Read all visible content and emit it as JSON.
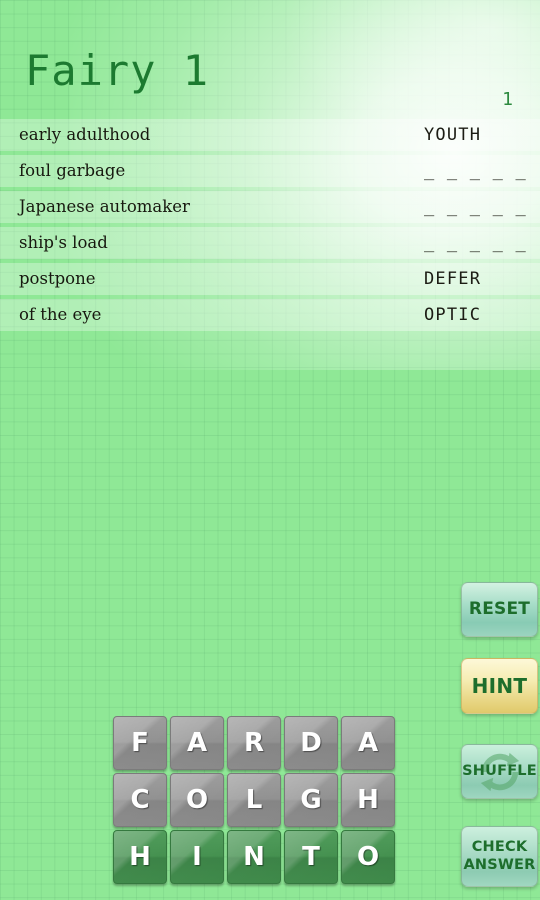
{
  "app": {
    "title": "Fairy 1",
    "puzzle_number": "1",
    "background_color": "#8fe896",
    "title_color": "#1c7a30"
  },
  "clues": {
    "items": [
      {
        "clue": "early adulthood",
        "answer": "YOUTH",
        "solved": true
      },
      {
        "clue": "foul garbage",
        "answer": "_ _ _ _ _",
        "solved": false
      },
      {
        "clue": "Japanese automaker",
        "answer": "_ _ _ _ _",
        "solved": false
      },
      {
        "clue": "ship's load",
        "answer": "_ _ _ _ _",
        "solved": false
      },
      {
        "clue": "postpone",
        "answer": "DEFER",
        "solved": true
      },
      {
        "clue": "of the eye",
        "answer": "OPTIC",
        "solved": true
      }
    ]
  },
  "tiles": {
    "rows": [
      {
        "letters": [
          "F",
          "A",
          "R",
          "D",
          "A"
        ],
        "state": "available",
        "color": "#8a8a8a"
      },
      {
        "letters": [
          "C",
          "O",
          "L",
          "G",
          "H"
        ],
        "state": "available",
        "color": "#8a8a8a"
      },
      {
        "letters": [
          "H",
          "I",
          "N",
          "T",
          "O"
        ],
        "state": "used",
        "color": "#3f8a4a"
      }
    ]
  },
  "buttons": {
    "reset": {
      "label": "RESET",
      "color": "#9bd4bf"
    },
    "hint": {
      "label": "HINT",
      "color": "#e0c96b"
    },
    "shuffle": {
      "label": "SHUFFLE",
      "icon": "refresh-cycle-icon",
      "color": "#9ed6c0"
    },
    "check": {
      "label_line1": "CHECK",
      "label_line2": "ANSWER",
      "color": "#a0d7c1"
    }
  }
}
